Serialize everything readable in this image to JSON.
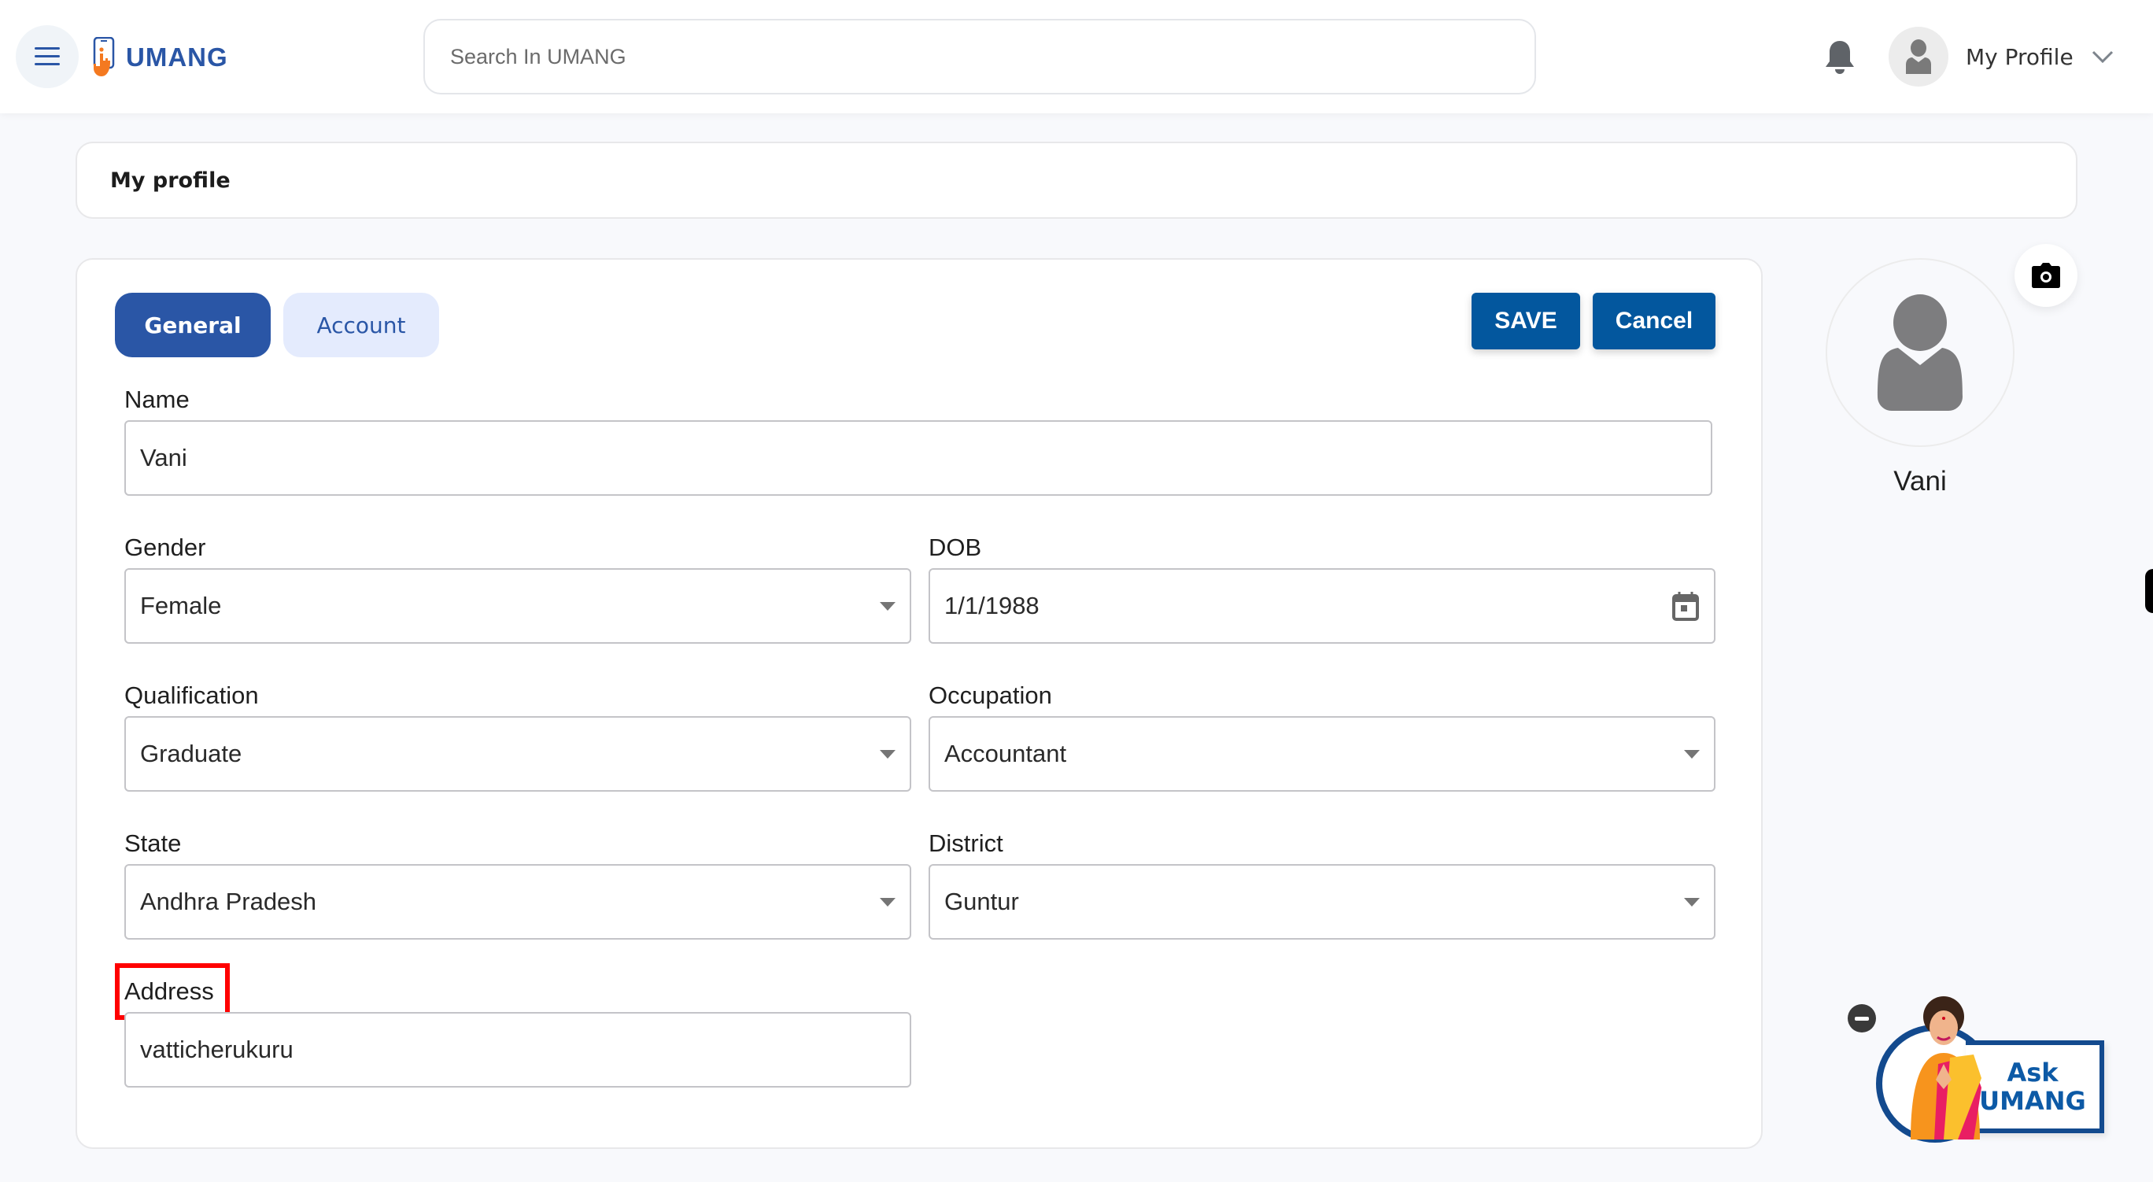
{
  "header": {
    "brand": "UMANG",
    "search_placeholder": "Search In UMANG",
    "profile_label": "My Profile",
    "icons": {
      "menu": "hamburger-icon",
      "notifications": "bell-icon",
      "avatar": "user-icon",
      "dropdown": "chevron-down-icon"
    }
  },
  "breadcrumb": {
    "title": "My profile"
  },
  "tabs": [
    {
      "label": "General",
      "active": true
    },
    {
      "label": "Account",
      "active": false
    }
  ],
  "actions": {
    "save_label": "SAVE",
    "cancel_label": "Cancel"
  },
  "form": {
    "name": {
      "label": "Name",
      "value": "Vani"
    },
    "gender": {
      "label": "Gender",
      "value": "Female"
    },
    "dob": {
      "label": "DOB",
      "value": "1/1/1988"
    },
    "qualification": {
      "label": "Qualification",
      "value": "Graduate"
    },
    "occupation": {
      "label": "Occupation",
      "value": "Accountant"
    },
    "state": {
      "label": "State",
      "value": "Andhra Pradesh"
    },
    "district": {
      "label": "District",
      "value": "Guntur"
    },
    "address": {
      "label": "Address",
      "value": "vatticherukuru"
    }
  },
  "profile_card": {
    "display_name": "Vani",
    "camera_icon": "camera-icon"
  },
  "ask_umang": {
    "line1": "Ask",
    "line2": "UMANG"
  },
  "colors": {
    "brand_blue": "#2a56a6",
    "button_blue": "#03579e",
    "tab_inactive_bg": "#e4ebfd",
    "highlight": "#ff0000",
    "logo_orange": "#f47920"
  }
}
